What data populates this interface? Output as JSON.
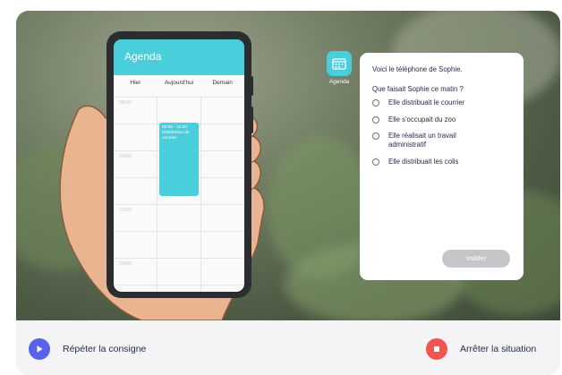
{
  "phone": {
    "app_title": "Agenda",
    "columns": [
      "Hier",
      "Aujourd'hui",
      "Demain"
    ],
    "times": [
      "08h00",
      "10h00",
      "12h00",
      "14h00"
    ],
    "event": {
      "time": "08:00 - 11:00",
      "title": "Distribution du courrier"
    }
  },
  "agenda_app": {
    "label": "Agenda",
    "icon": "calendar-icon"
  },
  "panel": {
    "intro": "Voici le téléphone de Sophie.",
    "question": "Que faisait Sophie ce matin ?",
    "options": [
      "Elle distribuait le courrier",
      "Elle s'occupait du zoo",
      "Elle réalisait un travail administratif",
      "Elle distribuait les colis"
    ],
    "validate_label": "Valider"
  },
  "bottom": {
    "repeat_label": "Répéter la consigne",
    "stop_label": "Arrêter la situation"
  },
  "colors": {
    "accent": "#48cfdb",
    "play": "#5a63e8",
    "stop": "#f2544f"
  }
}
